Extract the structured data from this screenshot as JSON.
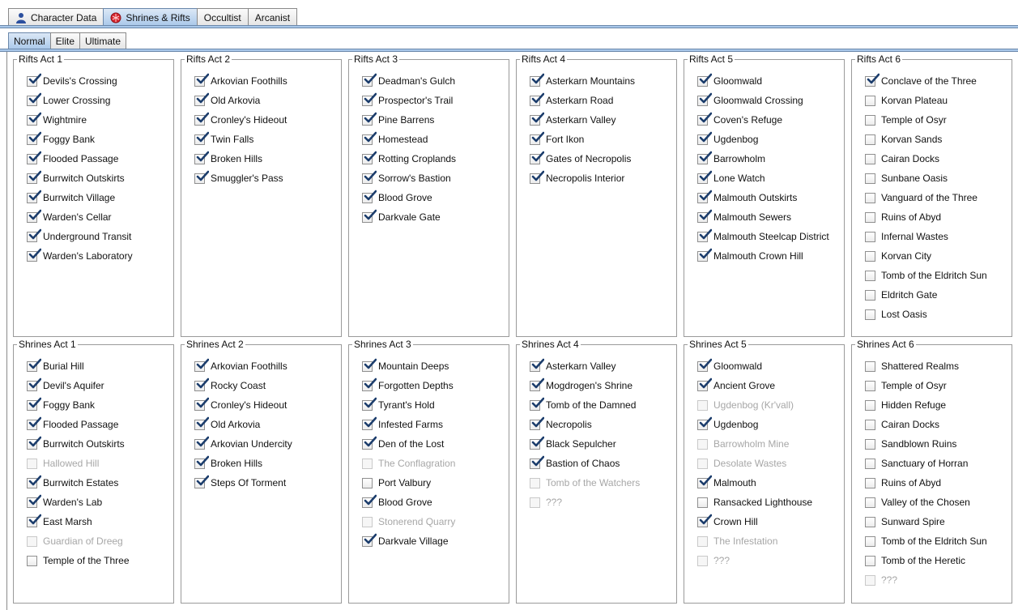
{
  "top_tabs": [
    {
      "label": "Character Data",
      "icon": "user-icon",
      "selected": false
    },
    {
      "label": "Shrines & Rifts",
      "icon": "shrine-icon",
      "selected": true
    },
    {
      "label": "Occultist",
      "selected": false
    },
    {
      "label": "Arcanist",
      "selected": false
    }
  ],
  "sub_tabs": [
    {
      "label": "Normal",
      "selected": true
    },
    {
      "label": "Elite",
      "selected": false
    },
    {
      "label": "Ultimate",
      "selected": false
    }
  ],
  "colors": {
    "tab_selected": "#a9c8ea",
    "tab_border": "#6a87aa",
    "check": "#1c3d6c",
    "disabled_text": "#a7a7a7"
  },
  "panels": [
    {
      "title": "Rifts Act 1",
      "items": [
        {
          "label": "Devils's Crossing",
          "checked": true
        },
        {
          "label": "Lower Crossing",
          "checked": true
        },
        {
          "label": "Wightmire",
          "checked": true
        },
        {
          "label": "Foggy Bank",
          "checked": true
        },
        {
          "label": "Flooded Passage",
          "checked": true
        },
        {
          "label": "Burrwitch Outskirts",
          "checked": true
        },
        {
          "label": "Burrwitch Village",
          "checked": true
        },
        {
          "label": "Warden's Cellar",
          "checked": true
        },
        {
          "label": "Underground Transit",
          "checked": true
        },
        {
          "label": "Warden's Laboratory",
          "checked": true
        }
      ]
    },
    {
      "title": "Rifts Act 2",
      "items": [
        {
          "label": "Arkovian Foothills",
          "checked": true
        },
        {
          "label": "Old Arkovia",
          "checked": true
        },
        {
          "label": "Cronley's Hideout",
          "checked": true
        },
        {
          "label": "Twin Falls",
          "checked": true
        },
        {
          "label": "Broken Hills",
          "checked": true
        },
        {
          "label": "Smuggler's Pass",
          "checked": true
        }
      ]
    },
    {
      "title": "Rifts Act 3",
      "items": [
        {
          "label": "Deadman's Gulch",
          "checked": true
        },
        {
          "label": "Prospector's Trail",
          "checked": true
        },
        {
          "label": "Pine Barrens",
          "checked": true
        },
        {
          "label": "Homestead",
          "checked": true
        },
        {
          "label": "Rotting Croplands",
          "checked": true
        },
        {
          "label": "Sorrow's Bastion",
          "checked": true
        },
        {
          "label": "Blood Grove",
          "checked": true
        },
        {
          "label": "Darkvale Gate",
          "checked": true
        }
      ]
    },
    {
      "title": "Rifts Act 4",
      "items": [
        {
          "label": "Asterkarn Mountains",
          "checked": true
        },
        {
          "label": "Asterkarn Road",
          "checked": true
        },
        {
          "label": "Asterkarn Valley",
          "checked": true
        },
        {
          "label": "Fort Ikon",
          "checked": true
        },
        {
          "label": "Gates of Necropolis",
          "checked": true
        },
        {
          "label": "Necropolis Interior",
          "checked": true
        }
      ]
    },
    {
      "title": "Rifts Act 5",
      "items": [
        {
          "label": "Gloomwald",
          "checked": true
        },
        {
          "label": "Gloomwald Crossing",
          "checked": true
        },
        {
          "label": "Coven's Refuge",
          "checked": true
        },
        {
          "label": "Ugdenbog",
          "checked": true
        },
        {
          "label": "Barrowholm",
          "checked": true
        },
        {
          "label": "Lone Watch",
          "checked": true
        },
        {
          "label": "Malmouth Outskirts",
          "checked": true
        },
        {
          "label": "Malmouth Sewers",
          "checked": true
        },
        {
          "label": "Malmouth Steelcap District",
          "checked": true
        },
        {
          "label": "Malmouth Crown Hill",
          "checked": true
        }
      ]
    },
    {
      "title": "Rifts Act 6",
      "items": [
        {
          "label": "Conclave of the Three",
          "checked": true
        },
        {
          "label": "Korvan Plateau",
          "checked": false
        },
        {
          "label": "Temple of Osyr",
          "checked": false
        },
        {
          "label": "Korvan Sands",
          "checked": false
        },
        {
          "label": "Cairan Docks",
          "checked": false
        },
        {
          "label": "Sunbane Oasis",
          "checked": false
        },
        {
          "label": "Vanguard of the Three",
          "checked": false
        },
        {
          "label": "Ruins of Abyd",
          "checked": false
        },
        {
          "label": "Infernal Wastes",
          "checked": false
        },
        {
          "label": "Korvan City",
          "checked": false
        },
        {
          "label": "Tomb of the Eldritch Sun",
          "checked": false
        },
        {
          "label": "Eldritch Gate",
          "checked": false
        },
        {
          "label": "Lost Oasis",
          "checked": false
        }
      ]
    },
    {
      "title": "Shrines Act 1",
      "items": [
        {
          "label": "Burial Hill",
          "checked": true
        },
        {
          "label": "Devil's Aquifer",
          "checked": true
        },
        {
          "label": "Foggy Bank",
          "checked": true
        },
        {
          "label": "Flooded Passage",
          "checked": true
        },
        {
          "label": "Burrwitch Outskirts",
          "checked": true
        },
        {
          "label": "Hallowed Hill",
          "checked": false,
          "disabled": true
        },
        {
          "label": "Burrwitch Estates",
          "checked": true
        },
        {
          "label": "Warden's Lab",
          "checked": true
        },
        {
          "label": "East Marsh",
          "checked": true
        },
        {
          "label": "Guardian of Dreeg",
          "checked": false,
          "disabled": true
        },
        {
          "label": "Temple of the Three",
          "checked": false
        }
      ]
    },
    {
      "title": "Shrines Act 2",
      "items": [
        {
          "label": "Arkovian Foothills",
          "checked": true
        },
        {
          "label": "Rocky Coast",
          "checked": true
        },
        {
          "label": "Cronley's Hideout",
          "checked": true
        },
        {
          "label": "Old Arkovia",
          "checked": true
        },
        {
          "label": "Arkovian Undercity",
          "checked": true
        },
        {
          "label": "Broken Hills",
          "checked": true
        },
        {
          "label": "Steps Of Torment",
          "checked": true
        }
      ]
    },
    {
      "title": "Shrines Act 3",
      "items": [
        {
          "label": "Mountain Deeps",
          "checked": true
        },
        {
          "label": "Forgotten Depths",
          "checked": true
        },
        {
          "label": "Tyrant's Hold",
          "checked": true
        },
        {
          "label": "Infested Farms",
          "checked": true
        },
        {
          "label": "Den of the Lost",
          "checked": true
        },
        {
          "label": "The Conflagration",
          "checked": false,
          "disabled": true
        },
        {
          "label": "Port Valbury",
          "checked": false
        },
        {
          "label": "Blood Grove",
          "checked": true
        },
        {
          "label": "Stonerend Quarry",
          "checked": false,
          "disabled": true
        },
        {
          "label": "Darkvale Village",
          "checked": true
        }
      ]
    },
    {
      "title": "Shrines Act 4",
      "items": [
        {
          "label": "Asterkarn Valley",
          "checked": true
        },
        {
          "label": "Mogdrogen's Shrine",
          "checked": true
        },
        {
          "label": "Tomb of the Damned",
          "checked": true
        },
        {
          "label": "Necropolis",
          "checked": true
        },
        {
          "label": "Black Sepulcher",
          "checked": true
        },
        {
          "label": "Bastion of Chaos",
          "checked": true
        },
        {
          "label": "Tomb of the Watchers",
          "checked": false,
          "disabled": true
        },
        {
          "label": "???",
          "checked": false,
          "disabled": true
        }
      ]
    },
    {
      "title": "Shrines Act 5",
      "items": [
        {
          "label": "Gloomwald",
          "checked": true
        },
        {
          "label": "Ancient Grove",
          "checked": true
        },
        {
          "label": "Ugdenbog (Kr'vall)",
          "checked": false,
          "disabled": true
        },
        {
          "label": "Ugdenbog",
          "checked": true
        },
        {
          "label": "Barrowholm Mine",
          "checked": false,
          "disabled": true
        },
        {
          "label": "Desolate Wastes",
          "checked": false,
          "disabled": true
        },
        {
          "label": "Malmouth",
          "checked": true
        },
        {
          "label": "Ransacked Lighthouse",
          "checked": false
        },
        {
          "label": "Crown Hill",
          "checked": true
        },
        {
          "label": "The Infestation",
          "checked": false,
          "disabled": true
        },
        {
          "label": "???",
          "checked": false,
          "disabled": true
        }
      ]
    },
    {
      "title": "Shrines Act 6",
      "items": [
        {
          "label": "Shattered Realms",
          "checked": false
        },
        {
          "label": "Temple of Osyr",
          "checked": false
        },
        {
          "label": "Hidden Refuge",
          "checked": false
        },
        {
          "label": "Cairan Docks",
          "checked": false
        },
        {
          "label": "Sandblown Ruins",
          "checked": false
        },
        {
          "label": "Sanctuary of Horran",
          "checked": false
        },
        {
          "label": "Ruins of Abyd",
          "checked": false
        },
        {
          "label": "Valley of the Chosen",
          "checked": false
        },
        {
          "label": "Sunward Spire",
          "checked": false
        },
        {
          "label": "Tomb of the Eldritch Sun",
          "checked": false
        },
        {
          "label": "Tomb of the Heretic",
          "checked": false
        },
        {
          "label": "???",
          "checked": false,
          "disabled": true
        }
      ]
    }
  ]
}
